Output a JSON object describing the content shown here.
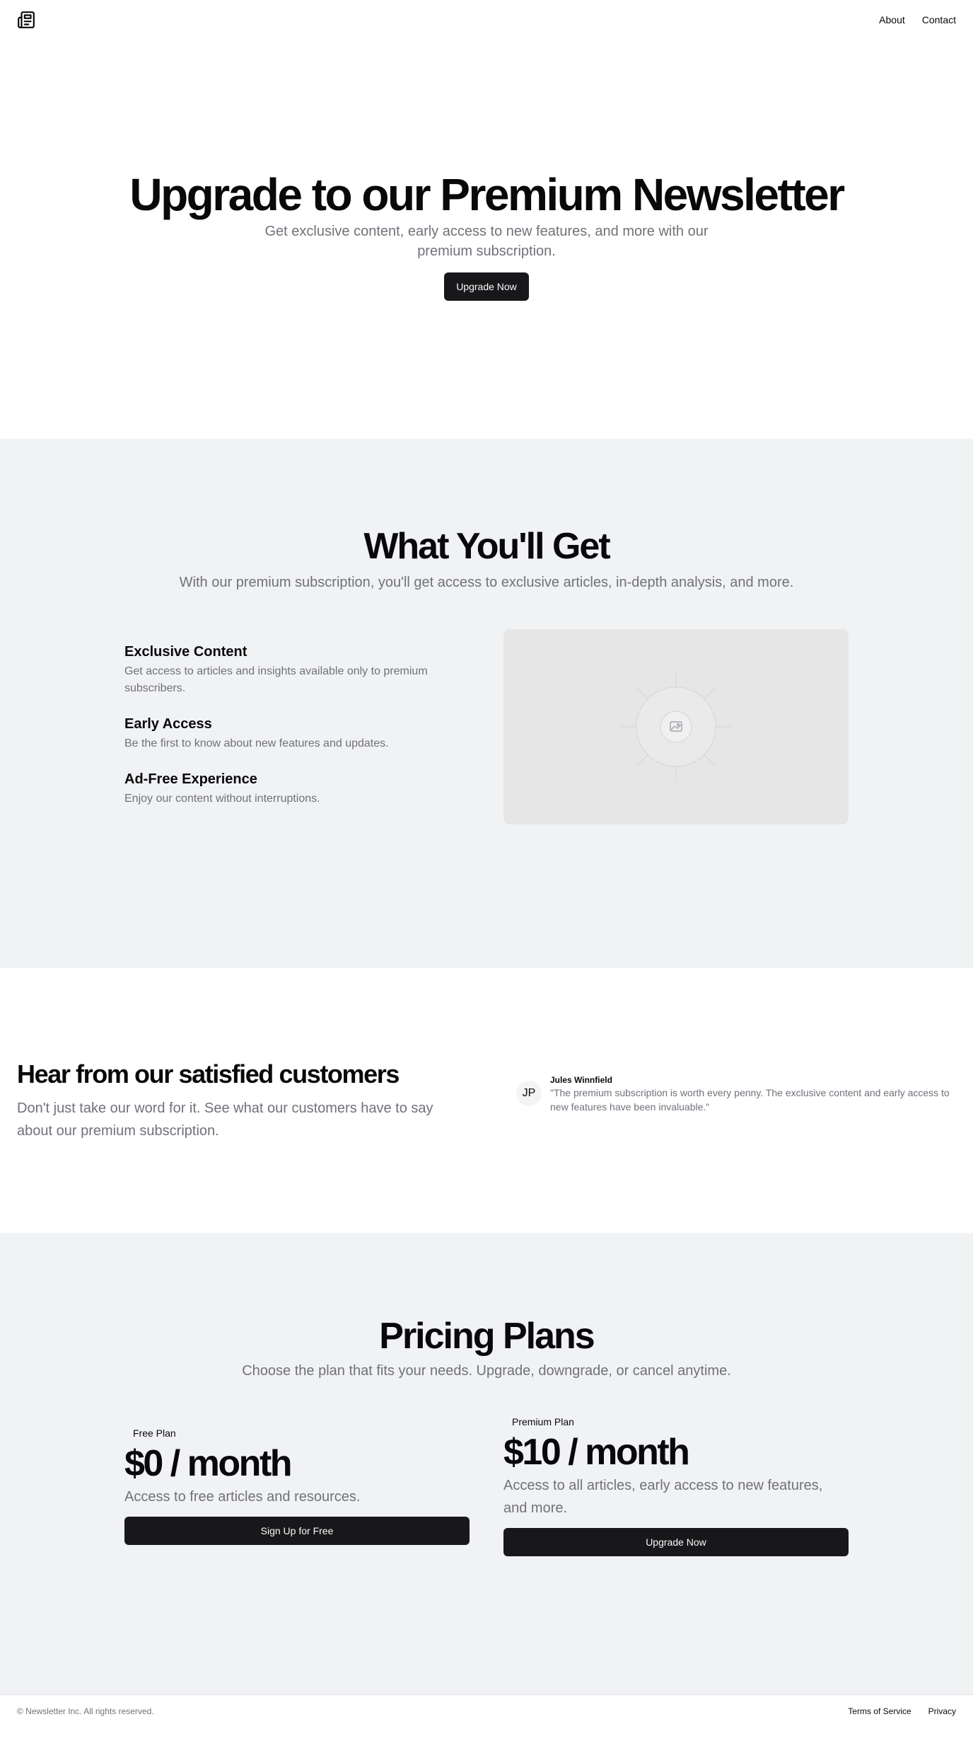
{
  "header": {
    "logo_icon": "newspaper-icon",
    "nav": [
      {
        "label": "About"
      },
      {
        "label": "Contact"
      }
    ]
  },
  "hero": {
    "title": "Upgrade to our Premium Newsletter",
    "subtitle": "Get exclusive content, early access to new features, and more with our premium subscription.",
    "cta_label": "Upgrade Now"
  },
  "features": {
    "title": "What You'll Get",
    "subtitle": "With our premium subscription, you'll get access to exclusive articles, in-depth analysis, and more.",
    "items": [
      {
        "title": "Exclusive Content",
        "description": "Get access to articles and insights available only to premium subscribers."
      },
      {
        "title": "Early Access",
        "description": "Be the first to know about new features and updates."
      },
      {
        "title": "Ad-Free Experience",
        "description": "Enjoy our content without interruptions."
      }
    ],
    "image_icon": "image-placeholder-icon"
  },
  "testimonials": {
    "title": "Hear from our satisfied customers",
    "subtitle": "Don't just take our word for it. See what our customers have to say about our premium subscription.",
    "items": [
      {
        "initials": "JP",
        "name": "Jules Winnfield",
        "quote": "\"The premium subscription is worth every penny. The exclusive content and early access to new features have been invaluable.\""
      }
    ]
  },
  "pricing": {
    "title": "Pricing Plans",
    "subtitle": "Choose the plan that fits your needs. Upgrade, downgrade, or cancel anytime.",
    "plans": [
      {
        "badge": "Free Plan",
        "price": "$0 / month",
        "description": "Access to free articles and resources.",
        "cta_label": "Sign Up for Free"
      },
      {
        "badge": "Premium Plan",
        "price": "$10 / month",
        "description": "Access to all articles, early access to new features, and more.",
        "cta_label": "Upgrade Now"
      }
    ]
  },
  "footer": {
    "copyright": "© Newsletter Inc. All rights reserved.",
    "links": [
      {
        "label": "Terms of Service"
      },
      {
        "label": "Privacy"
      }
    ]
  },
  "colors": {
    "primary_button": "#18181b",
    "muted_text": "#71717a",
    "section_background": "#f1f2f4"
  }
}
